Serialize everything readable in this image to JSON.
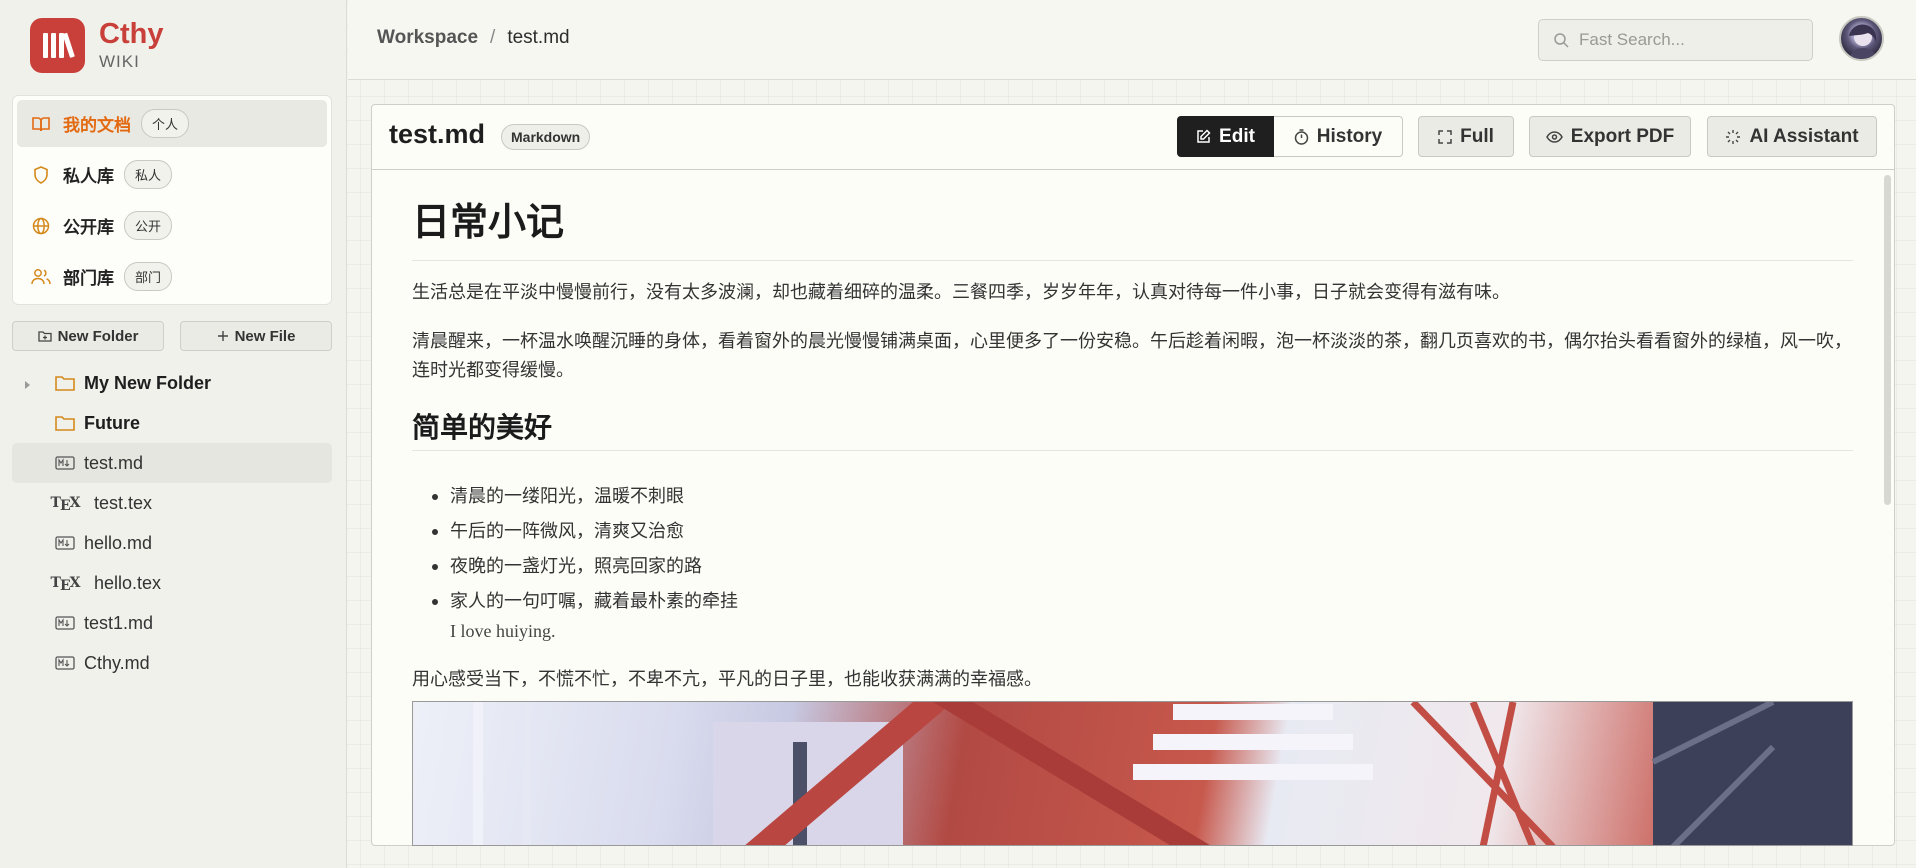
{
  "brand": {
    "name": "Cthy",
    "sub": "WIKI"
  },
  "libraries": [
    {
      "label": "我的文档",
      "tag": "个人",
      "icon": "book-open-icon",
      "active": true
    },
    {
      "label": "私人库",
      "tag": "私人",
      "icon": "shield-icon",
      "active": false
    },
    {
      "label": "公开库",
      "tag": "公开",
      "icon": "globe-icon",
      "active": false
    },
    {
      "label": "部门库",
      "tag": "部门",
      "icon": "users-icon",
      "active": false
    }
  ],
  "sidebar_actions": {
    "new_folder": "New Folder",
    "new_file": "New File"
  },
  "tree": [
    {
      "label": "My New Folder",
      "type": "folder"
    },
    {
      "label": "Future",
      "type": "folder"
    },
    {
      "label": "test.md",
      "type": "md",
      "active": true
    },
    {
      "label": "test.tex",
      "type": "tex"
    },
    {
      "label": "hello.md",
      "type": "md"
    },
    {
      "label": "hello.tex",
      "type": "tex"
    },
    {
      "label": "test1.md",
      "type": "md"
    },
    {
      "label": "Cthy.md",
      "type": "md"
    }
  ],
  "header": {
    "breadcrumb_root": "Workspace",
    "breadcrumb_sep": "/",
    "breadcrumb_current": "test.md",
    "search_placeholder": "Fast Search..."
  },
  "document": {
    "title": "test.md",
    "badge": "Markdown",
    "toolbar": {
      "edit": "Edit",
      "history": "History",
      "full": "Full",
      "export": "Export PDF",
      "ai": "AI Assistant"
    },
    "h1": "日常小记",
    "p1": "生活总是在平淡中慢慢前行，没有太多波澜，却也藏着细碎的温柔。三餐四季，岁岁年年，认真对待每一件小事，日子就会变得有滋有味。",
    "p2": "清晨醒来，一杯温水唤醒沉睡的身体，看着窗外的晨光慢慢铺满桌面，心里便多了一份安稳。午后趁着闲暇，泡一杯淡淡的茶，翻几页喜欢的书，偶尔抬头看看窗外的绿植，风一吹，连时光都变得缓慢。",
    "h2": "简单的美好",
    "list": [
      "清晨的一缕阳光，温暖不刺眼",
      "午后的一阵微风，清爽又治愈",
      "夜晚的一盏灯光，照亮回家的路",
      "家人的一句叮嘱，藏着最朴素的牵挂"
    ],
    "quote": "I love huiying.",
    "p3": "用心感受当下，不慌不忙，不卑不亢，平凡的日子里，也能收获满满的幸福感。"
  },
  "colors": {
    "brand": "#c9403a",
    "active_library": "#e36a12",
    "folder_icon": "#d4891c"
  }
}
